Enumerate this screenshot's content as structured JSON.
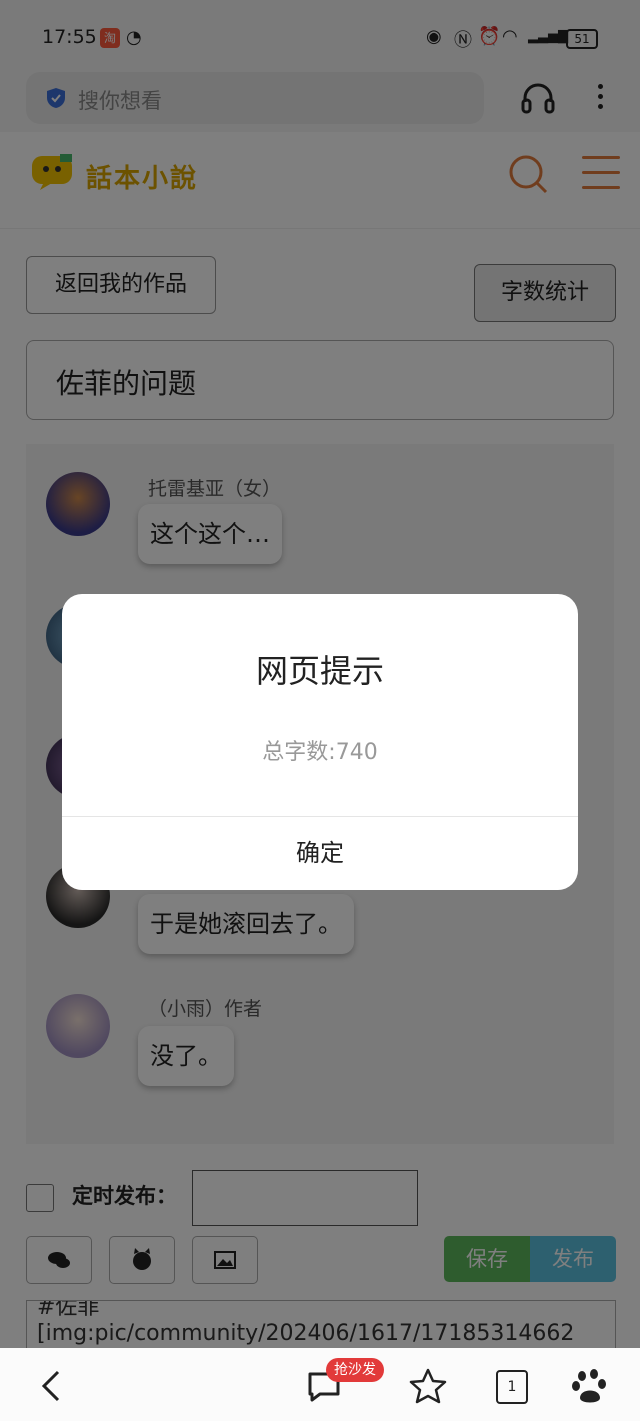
{
  "status_bar": {
    "time": "17:55",
    "battery": "51"
  },
  "browser": {
    "search_placeholder": "搜你想看"
  },
  "site": {
    "logo_text": "話本小說"
  },
  "page": {
    "back_button": "返回我的作品",
    "word_count_button": "字数统计",
    "title": "佐菲的问题"
  },
  "chat": {
    "messages": [
      {
        "speaker": "托雷基亚（女）",
        "text": "这个这个…"
      },
      {
        "speaker": "",
        "text": "于是她滚回去了。"
      },
      {
        "speaker": "（小雨）作者",
        "text": "没了。"
      }
    ]
  },
  "controls": {
    "timed_publish_label": "定时发布：",
    "save": "保存",
    "publish": "发布",
    "editor_lines": [
      "#佐菲",
      "[img:pic/community/202406/1617/17185314662"
    ]
  },
  "dialog": {
    "title": "网页提示",
    "message": "总字数:740",
    "confirm": "确定"
  },
  "bottom_nav": {
    "badge": "抢沙发",
    "tabs_count": "1"
  },
  "colors": {
    "accent": "#e07a3c",
    "save": "#5cb85c",
    "publish": "#5bc0de",
    "badge": "#e23a3a"
  }
}
